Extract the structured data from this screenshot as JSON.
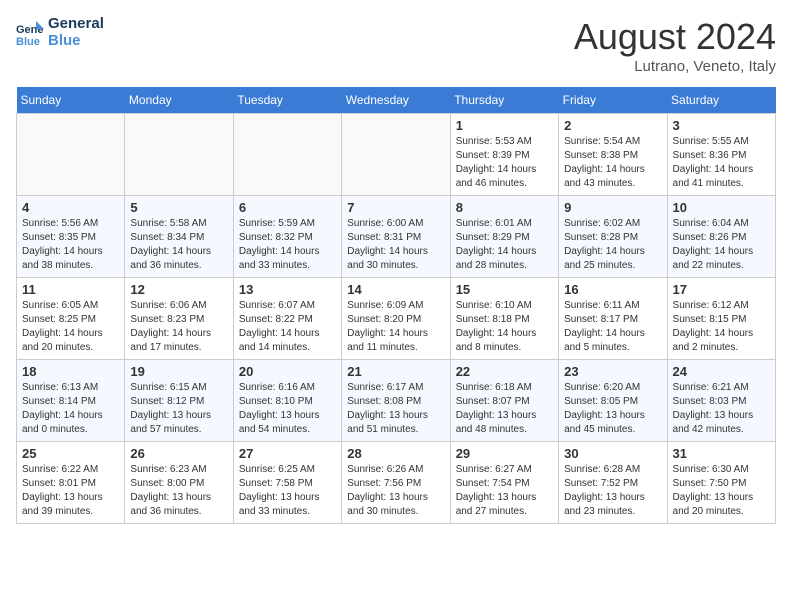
{
  "header": {
    "logo_line1": "General",
    "logo_line2": "Blue",
    "month_title": "August 2024",
    "location": "Lutrano, Veneto, Italy"
  },
  "weekdays": [
    "Sunday",
    "Monday",
    "Tuesday",
    "Wednesday",
    "Thursday",
    "Friday",
    "Saturday"
  ],
  "weeks": [
    [
      {
        "day": "",
        "info": ""
      },
      {
        "day": "",
        "info": ""
      },
      {
        "day": "",
        "info": ""
      },
      {
        "day": "",
        "info": ""
      },
      {
        "day": "1",
        "info": "Sunrise: 5:53 AM\nSunset: 8:39 PM\nDaylight: 14 hours and 46 minutes."
      },
      {
        "day": "2",
        "info": "Sunrise: 5:54 AM\nSunset: 8:38 PM\nDaylight: 14 hours and 43 minutes."
      },
      {
        "day": "3",
        "info": "Sunrise: 5:55 AM\nSunset: 8:36 PM\nDaylight: 14 hours and 41 minutes."
      }
    ],
    [
      {
        "day": "4",
        "info": "Sunrise: 5:56 AM\nSunset: 8:35 PM\nDaylight: 14 hours and 38 minutes."
      },
      {
        "day": "5",
        "info": "Sunrise: 5:58 AM\nSunset: 8:34 PM\nDaylight: 14 hours and 36 minutes."
      },
      {
        "day": "6",
        "info": "Sunrise: 5:59 AM\nSunset: 8:32 PM\nDaylight: 14 hours and 33 minutes."
      },
      {
        "day": "7",
        "info": "Sunrise: 6:00 AM\nSunset: 8:31 PM\nDaylight: 14 hours and 30 minutes."
      },
      {
        "day": "8",
        "info": "Sunrise: 6:01 AM\nSunset: 8:29 PM\nDaylight: 14 hours and 28 minutes."
      },
      {
        "day": "9",
        "info": "Sunrise: 6:02 AM\nSunset: 8:28 PM\nDaylight: 14 hours and 25 minutes."
      },
      {
        "day": "10",
        "info": "Sunrise: 6:04 AM\nSunset: 8:26 PM\nDaylight: 14 hours and 22 minutes."
      }
    ],
    [
      {
        "day": "11",
        "info": "Sunrise: 6:05 AM\nSunset: 8:25 PM\nDaylight: 14 hours and 20 minutes."
      },
      {
        "day": "12",
        "info": "Sunrise: 6:06 AM\nSunset: 8:23 PM\nDaylight: 14 hours and 17 minutes."
      },
      {
        "day": "13",
        "info": "Sunrise: 6:07 AM\nSunset: 8:22 PM\nDaylight: 14 hours and 14 minutes."
      },
      {
        "day": "14",
        "info": "Sunrise: 6:09 AM\nSunset: 8:20 PM\nDaylight: 14 hours and 11 minutes."
      },
      {
        "day": "15",
        "info": "Sunrise: 6:10 AM\nSunset: 8:18 PM\nDaylight: 14 hours and 8 minutes."
      },
      {
        "day": "16",
        "info": "Sunrise: 6:11 AM\nSunset: 8:17 PM\nDaylight: 14 hours and 5 minutes."
      },
      {
        "day": "17",
        "info": "Sunrise: 6:12 AM\nSunset: 8:15 PM\nDaylight: 14 hours and 2 minutes."
      }
    ],
    [
      {
        "day": "18",
        "info": "Sunrise: 6:13 AM\nSunset: 8:14 PM\nDaylight: 14 hours and 0 minutes."
      },
      {
        "day": "19",
        "info": "Sunrise: 6:15 AM\nSunset: 8:12 PM\nDaylight: 13 hours and 57 minutes."
      },
      {
        "day": "20",
        "info": "Sunrise: 6:16 AM\nSunset: 8:10 PM\nDaylight: 13 hours and 54 minutes."
      },
      {
        "day": "21",
        "info": "Sunrise: 6:17 AM\nSunset: 8:08 PM\nDaylight: 13 hours and 51 minutes."
      },
      {
        "day": "22",
        "info": "Sunrise: 6:18 AM\nSunset: 8:07 PM\nDaylight: 13 hours and 48 minutes."
      },
      {
        "day": "23",
        "info": "Sunrise: 6:20 AM\nSunset: 8:05 PM\nDaylight: 13 hours and 45 minutes."
      },
      {
        "day": "24",
        "info": "Sunrise: 6:21 AM\nSunset: 8:03 PM\nDaylight: 13 hours and 42 minutes."
      }
    ],
    [
      {
        "day": "25",
        "info": "Sunrise: 6:22 AM\nSunset: 8:01 PM\nDaylight: 13 hours and 39 minutes."
      },
      {
        "day": "26",
        "info": "Sunrise: 6:23 AM\nSunset: 8:00 PM\nDaylight: 13 hours and 36 minutes."
      },
      {
        "day": "27",
        "info": "Sunrise: 6:25 AM\nSunset: 7:58 PM\nDaylight: 13 hours and 33 minutes."
      },
      {
        "day": "28",
        "info": "Sunrise: 6:26 AM\nSunset: 7:56 PM\nDaylight: 13 hours and 30 minutes."
      },
      {
        "day": "29",
        "info": "Sunrise: 6:27 AM\nSunset: 7:54 PM\nDaylight: 13 hours and 27 minutes."
      },
      {
        "day": "30",
        "info": "Sunrise: 6:28 AM\nSunset: 7:52 PM\nDaylight: 13 hours and 23 minutes."
      },
      {
        "day": "31",
        "info": "Sunrise: 6:30 AM\nSunset: 7:50 PM\nDaylight: 13 hours and 20 minutes."
      }
    ]
  ]
}
